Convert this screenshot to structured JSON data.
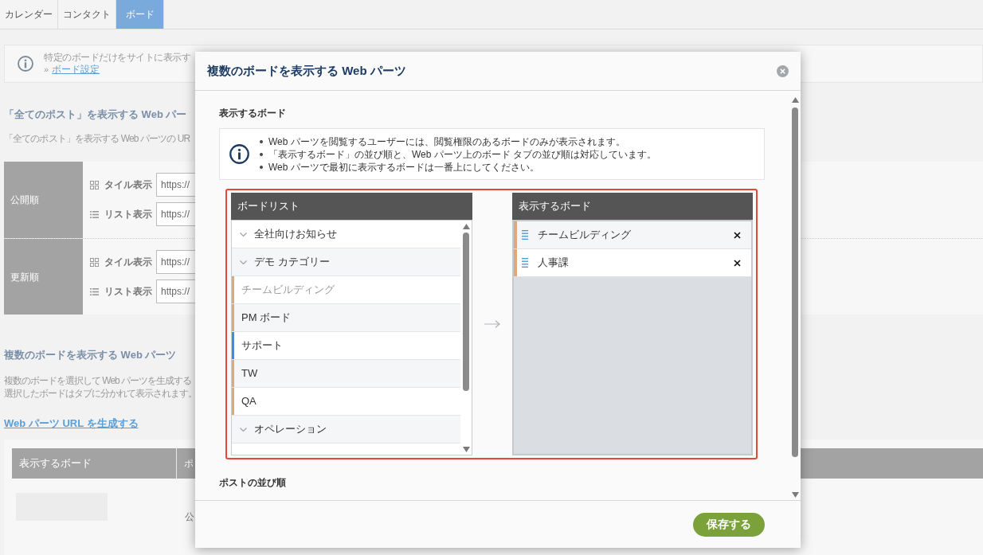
{
  "tabs": [
    {
      "label": "カレンダー",
      "selected": false
    },
    {
      "label": "コンタクト",
      "selected": false
    },
    {
      "label": "ボード",
      "selected": true
    }
  ],
  "notice": {
    "text": "特定のボードだけをサイトに表示す",
    "prefix": "»",
    "link": "ボード設定"
  },
  "all_posts": {
    "heading": "「全てのポスト」を表示する Web パー",
    "description": "「全てのポスト」を表示する Web パーツの UR",
    "orders": [
      {
        "label": "公開順",
        "views": [
          {
            "kind": "tile",
            "label": "タイル表示",
            "url": "https://"
          },
          {
            "kind": "list",
            "label": "リスト表示",
            "url": "https://"
          }
        ]
      },
      {
        "label": "更新順",
        "views": [
          {
            "kind": "tile",
            "label": "タイル表示",
            "url": "https://"
          },
          {
            "kind": "list",
            "label": "リスト表示",
            "url": "https://"
          }
        ]
      }
    ]
  },
  "multi_board": {
    "heading": "複数のボードを表示する Web パーツ",
    "description_lines": [
      "複数のボードを選択して Web パーツを生成する",
      "選択したボードはタブに分かれて表示されます。"
    ],
    "generate_link": "Web パーツ URL を生成する",
    "table": {
      "columns": [
        "表示するボード",
        "ポ"
      ],
      "rows": [
        {
          "column_2": "公"
        }
      ]
    }
  },
  "dialog": {
    "title": "複数のボードを表示する Web パーツ",
    "boards_section": {
      "label": "表示するボード",
      "notes": [
        "Web パーツを閲覧するユーザーには、閲覧権限のあるボードのみが表示されます。",
        "「表示するボード」の並び順と、Web パーツ上のボード タブの並び順は対応しています。",
        "Web パーツで最初に表示するボードは一番上にしてください。"
      ]
    },
    "board_list": {
      "title": "ボードリスト",
      "categories": [
        {
          "name": "全社向けお知らせ",
          "expanded": true
        },
        {
          "name": "デモ カテゴリー",
          "expanded": true,
          "boards": [
            {
              "name": "チームビルディング",
              "color": "#e0a877",
              "disabled": true
            },
            {
              "name": "PM ボード",
              "color": "#e0a877",
              "disabled": false
            },
            {
              "name": "サポート",
              "color": "#3b8cf0",
              "disabled": false
            },
            {
              "name": "TW",
              "color": "#e0a877",
              "disabled": false
            },
            {
              "name": "QA",
              "color": "#e0a877",
              "disabled": false
            }
          ]
        },
        {
          "name": "オペレーション",
          "expanded": true
        }
      ]
    },
    "selected_boards": {
      "title": "表示するボード",
      "items": [
        {
          "name": "チームビルディング",
          "color": "#e0a877"
        },
        {
          "name": "人事課",
          "color": "#e0a877"
        }
      ]
    },
    "sort_section": {
      "label": "ポストの並び順"
    },
    "save_button": "保存する"
  }
}
